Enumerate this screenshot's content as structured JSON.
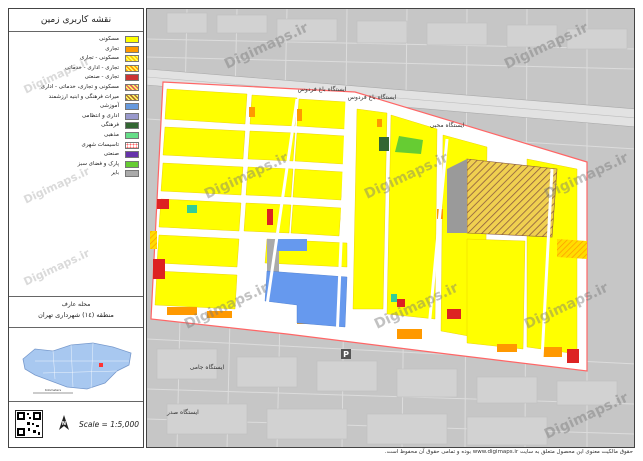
{
  "legend": {
    "title": "نقشه کاربری زمین",
    "items": [
      {
        "label": "مسکونی",
        "color": "#ffff00",
        "pattern": "solid"
      },
      {
        "label": "تجاری",
        "color": "#ff9900",
        "pattern": "solid"
      },
      {
        "label": "مسکونی - تجاری",
        "color": "#ffcc00",
        "pattern": "hatch"
      },
      {
        "label": "تجاری - اداری - خدماتی",
        "color": "#ff9900",
        "pattern": "hatch"
      },
      {
        "label": "تجاری - صنعتی",
        "color": "#cc3333",
        "pattern": "solid"
      },
      {
        "label": "مسکونی و تجاری، خدماتی - اداری",
        "color": "#e06060",
        "pattern": "hatch"
      },
      {
        "label": "میراث فرهنگی و ابنیه ارزشمند",
        "color": "#b07030",
        "pattern": "hatch"
      },
      {
        "label": "آموزشی",
        "color": "#6699dd",
        "pattern": "solid"
      },
      {
        "label": "اداری و انتظامی",
        "color": "#9999cc",
        "pattern": "solid"
      },
      {
        "label": "فرهنگی",
        "color": "#336633",
        "pattern": "solid"
      },
      {
        "label": "مذهبی",
        "color": "#66dd88",
        "pattern": "solid"
      },
      {
        "label": "تاسیسات شهری",
        "color": "#ff6666",
        "pattern": "dots"
      },
      {
        "label": "صنعتی",
        "color": "#6633aa",
        "pattern": "solid"
      },
      {
        "label": "پارک و فضای سبز",
        "color": "#66cc33",
        "pattern": "solid"
      },
      {
        "label": "بایر",
        "color": "#aaaaaa",
        "pattern": "solid"
      }
    ]
  },
  "district": {
    "line1": "محله عارف",
    "line2": "منطقه (١٤) شهرداری تهران"
  },
  "scale": "Scale = 1:5,000",
  "inset_scale_text": "Kilometers",
  "map": {
    "labels": [
      {
        "name": "station-label-1",
        "text": "ایستگاه باغ فردوس"
      },
      {
        "name": "station-label-2",
        "text": "ایستگاه باغ فردوس"
      },
      {
        "name": "station-label-3",
        "text": "ایستگاه محبی"
      },
      {
        "name": "station-label-4",
        "text": "ایستگاه جامی"
      },
      {
        "name": "station-label-5",
        "text": "ایستگاه صدر"
      }
    ],
    "watermark": "Digimaps.ir",
    "parking_symbol": "P"
  },
  "footer": {
    "credit": "حقوق مالکیت معنوی این محصول متعلق به سایت www.digimaps.ir بوده و تمامی حقوق آن محفوظ است."
  }
}
